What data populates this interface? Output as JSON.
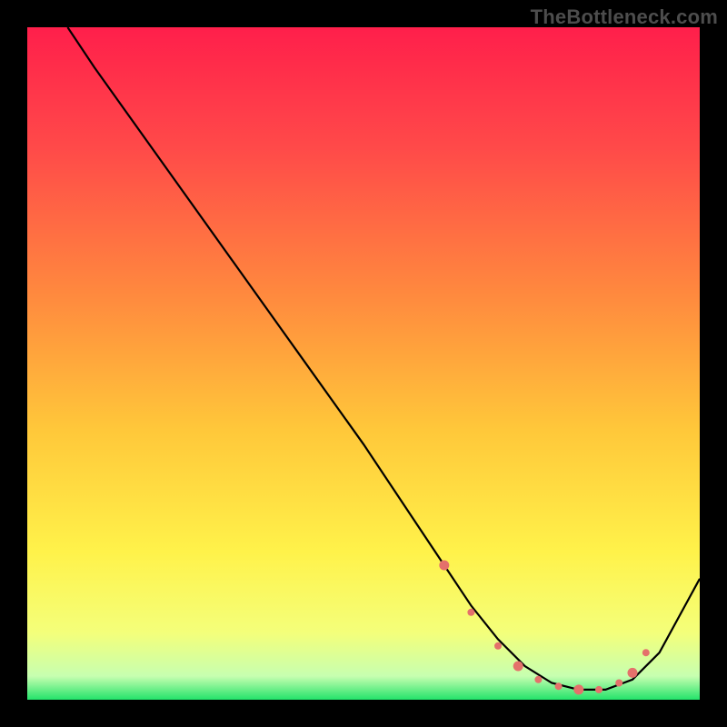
{
  "watermark": "TheBottleneck.com",
  "chart_data": {
    "type": "line",
    "title": "",
    "xlabel": "",
    "ylabel": "",
    "xlim": [
      0,
      100
    ],
    "ylim": [
      0,
      100
    ],
    "grid": false,
    "series": [
      {
        "name": "curve",
        "x": [
          6,
          10,
          20,
          30,
          40,
          50,
          58,
          62,
          66,
          70,
          74,
          78,
          82,
          86,
          90,
          94,
          100
        ],
        "y": [
          100,
          94,
          80,
          66,
          52,
          38,
          26,
          20,
          14,
          9,
          5,
          2.5,
          1.5,
          1.5,
          3,
          7,
          18
        ]
      }
    ],
    "markers": {
      "name": "highlight-dots",
      "x": [
        62,
        66,
        70,
        73,
        76,
        79,
        82,
        85,
        88,
        90,
        92
      ],
      "y": [
        20,
        13,
        8,
        5,
        3,
        2,
        1.5,
        1.5,
        2.5,
        4,
        7
      ]
    },
    "gradient_stops": [
      {
        "offset": 0.0,
        "color": "#ff1f4b"
      },
      {
        "offset": 0.18,
        "color": "#ff4a49"
      },
      {
        "offset": 0.4,
        "color": "#ff8a3e"
      },
      {
        "offset": 0.6,
        "color": "#ffc83a"
      },
      {
        "offset": 0.78,
        "color": "#fff24a"
      },
      {
        "offset": 0.9,
        "color": "#f4ff7a"
      },
      {
        "offset": 0.965,
        "color": "#c7ffb0"
      },
      {
        "offset": 1.0,
        "color": "#23e36a"
      }
    ],
    "stroke_color": "#000000",
    "marker_color": "#e4716b"
  }
}
